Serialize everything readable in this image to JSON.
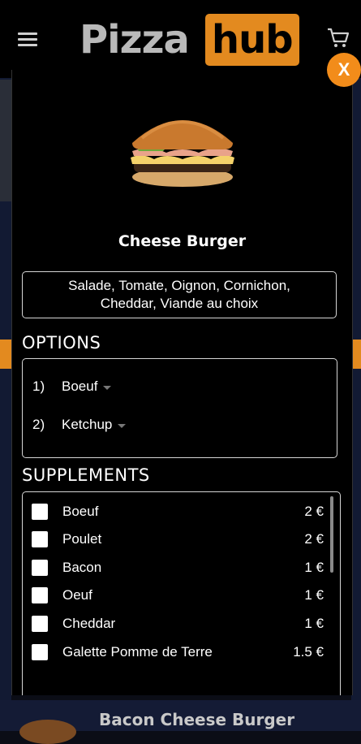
{
  "header": {
    "logo_left": "Pizza",
    "logo_right": "hub"
  },
  "modal": {
    "close_label": "X",
    "product_name": "Cheese Burger",
    "ingredients_line1": "Salade, Tomate, Oignon, Cornichon,",
    "ingredients_line2": "Cheddar, Viande au choix",
    "options_heading": "OPTIONS",
    "options": [
      {
        "number": "1)",
        "value": "Boeuf"
      },
      {
        "number": "2)",
        "value": "Ketchup"
      }
    ],
    "supplements_heading": "SUPPLEMENTS",
    "supplements": [
      {
        "name": "Boeuf",
        "price": "2 €"
      },
      {
        "name": "Poulet",
        "price": "2 €"
      },
      {
        "name": "Bacon",
        "price": "1 €"
      },
      {
        "name": "Oeuf",
        "price": "1 €"
      },
      {
        "name": "Cheddar",
        "price": "1 €"
      },
      {
        "name": "Galette Pomme de Terre",
        "price": "1.5 €"
      }
    ]
  },
  "background": {
    "next_product_name": "Bacon Cheese Burger"
  },
  "colors": {
    "accent": "#f28c1a",
    "logo_badge": "#e38a1f",
    "background": "#000000"
  },
  "icons": [
    "hamburger-menu-icon",
    "cart-icon",
    "close-icon",
    "caret-down-icon"
  ]
}
